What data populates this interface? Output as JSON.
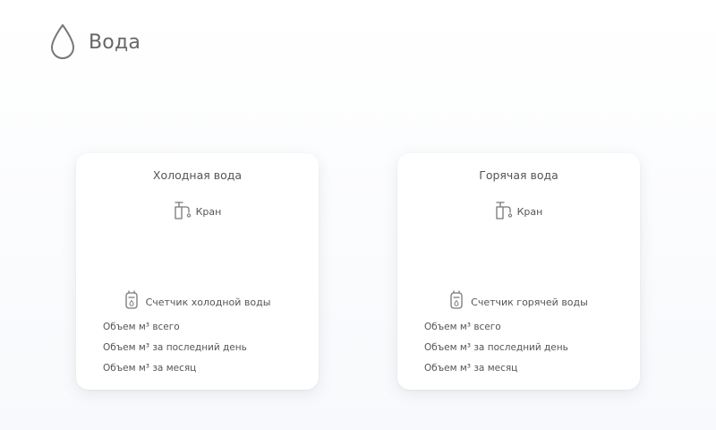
{
  "header": {
    "title": "Вода",
    "icon": "water-drop-icon"
  },
  "cards": [
    {
      "title": "Холодная вода",
      "tap_label": "Кран",
      "meter_label": "Счетчик холодной воды",
      "metrics": [
        "Объем м³ всего",
        "Объем м³ за последний день",
        "Объем м³ за месяц"
      ]
    },
    {
      "title": "Горячая вода",
      "tap_label": "Кран",
      "meter_label": "Счетчик горячей воды",
      "metrics": [
        "Объем м³ всего",
        "Объем м³ за последний день",
        "Объем м³ за месяц"
      ]
    }
  ],
  "colors": {
    "text": "#555555",
    "icon": "#777777",
    "card_bg": "#ffffff"
  }
}
